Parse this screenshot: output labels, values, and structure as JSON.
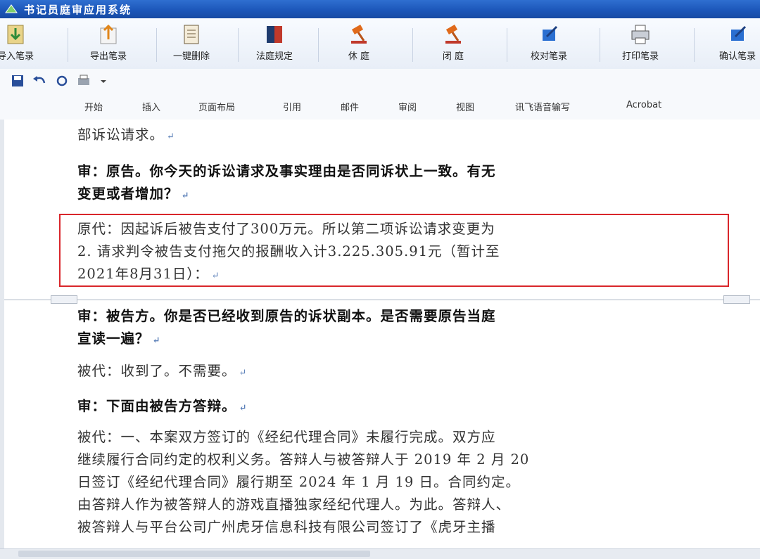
{
  "window": {
    "title": "书记员庭审应用系统"
  },
  "toolbar": {
    "buttons": [
      {
        "label": "导入笔录"
      },
      {
        "label": "导出笔录"
      },
      {
        "label": "一键删除"
      },
      {
        "label": "法庭规定"
      },
      {
        "label": "休 庭"
      },
      {
        "label": "闭 庭"
      },
      {
        "label": "校对笔录"
      },
      {
        "label": "打印笔录"
      },
      {
        "label": "确认笔录"
      }
    ]
  },
  "ribbon": {
    "tabs": [
      "开始",
      "插入",
      "页面布局",
      "引用",
      "邮件",
      "审阅",
      "视图",
      "讯飞语音输写",
      "Acrobat"
    ]
  },
  "document": {
    "lines": {
      "l0": "部诉讼请求。",
      "l1a": "审：原告。你今天的诉讼请求及事实理由是否同诉状上一致。有无",
      "l1b": "变更或者增加？",
      "l2a": "原代：因起诉后被告支付了300万元。所以第二项诉讼请求变更为",
      "l2b": "2. 请求判令被告支付拖欠的报酬收入计3.225.305.91元（暂计至",
      "l2c": "2021年8月31日）：",
      "l3a": "审：被告方。你是否已经收到原告的诉状副本。是否需要原告当庭",
      "l3b": "宣读一遍？",
      "l4": "被代：收到了。不需要。",
      "l5": "审：下面由被告方答辩。",
      "l6a": "被代：一、本案双方签订的《经纪代理合同》未履行完成。双方应",
      "l6b": "继续履行合同约定的权利义务。答辩人与被答辩人于 2019 年 2 月 20",
      "l6c": "日签订《经纪代理合同》履行期至 2024 年 1 月 19 日。合同约定。",
      "l6d": "由答辩人作为被答辩人的游戏直播独家经纪代理人。为此。答辩人、",
      "l6e": "被答辩人与平台公司广州虎牙信息科技有限公司签订了《虎牙主播"
    },
    "return_mark": "↵"
  },
  "colors": {
    "highlight_border": "#d9262b",
    "titlebar": "#1b55b8"
  }
}
